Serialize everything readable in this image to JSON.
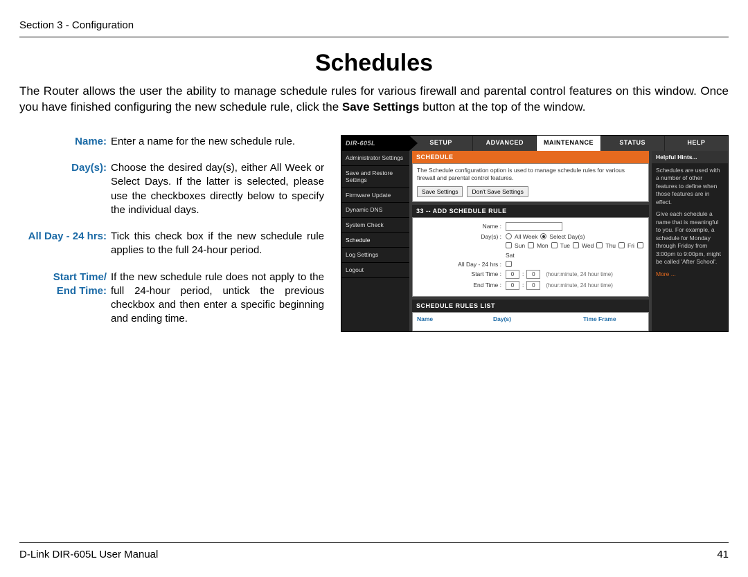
{
  "header": "Section 3 - Configuration",
  "title": "Schedules",
  "intro_parts": {
    "before_bold": "The Router allows the user the ability to manage schedule rules for various firewall and parental control features on this window. Once you have finished configuring the new schedule rule, click the ",
    "bold": "Save Settings",
    "after_bold": " button at the top of the window."
  },
  "definitions": [
    {
      "label": "Name:",
      "desc": "Enter a name for the new schedule rule."
    },
    {
      "label": "Day(s):",
      "desc": "Choose the desired day(s), either All Week or Select Days. If the latter is selected, please use the checkboxes directly below to specify the individual days."
    },
    {
      "label": "All Day - 24 hrs:",
      "desc": "Tick this check box if the new schedule rule applies to the full 24-hour period."
    },
    {
      "label": "Start Time/\nEnd Time:",
      "desc": "If the new schedule rule does not apply to the full 24-hour period, untick the previous checkbox and then enter a specific beginning and ending time."
    }
  ],
  "router": {
    "model": "DIR-605L",
    "tabs": [
      "SETUP",
      "ADVANCED",
      "MAINTENANCE",
      "STATUS",
      "HELP"
    ],
    "active_tab": 2,
    "sidenav": [
      "Administrator Settings",
      "Save and Restore Settings",
      "Firmware Update",
      "Dynamic DNS",
      "System Check",
      "Schedule",
      "Log Settings",
      "Logout"
    ],
    "active_side": 5,
    "panel": {
      "schedule_head": "SCHEDULE",
      "desc": "The Schedule configuration option is used to manage schedule rules for various firewall and parental control features.",
      "btn_save": "Save Settings",
      "btn_dont": "Don't Save Settings",
      "add_head": "33 -- ADD SCHEDULE RULE",
      "form": {
        "name_label": "Name :",
        "days_label": "Day(s) :",
        "days_opt_all": "All Week",
        "days_opt_sel": "Select Day(s)",
        "day_names": [
          "Sun",
          "Mon",
          "Tue",
          "Wed",
          "Thu",
          "Fri",
          "Sat"
        ],
        "allday_label": "All Day - 24 hrs :",
        "start_label": "Start Time :",
        "end_label": "End Time :",
        "time_sep": ":",
        "time_default": "0",
        "time_hint": "(hour:minute, 24 hour time)"
      },
      "list_head": "SCHEDULE RULES LIST",
      "list_cols": [
        "Name",
        "Day(s)",
        "Time Frame"
      ]
    },
    "help": {
      "head": "Helpful Hints...",
      "p1": "Schedules are used with a number of other features to define when those features are in effect.",
      "p2": "Give each schedule a name that is meaningful to you. For example, a schedule for Monday through Friday from 3:00pm to 9:00pm, might be called 'After School'.",
      "more": "More ..."
    }
  },
  "footer": {
    "left": "D-Link DIR-605L User Manual",
    "right": "41"
  }
}
